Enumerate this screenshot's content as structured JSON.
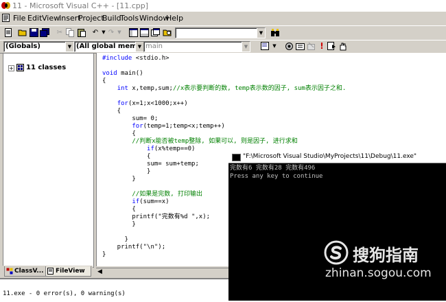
{
  "window": {
    "title": "11 - Microsoft Visual C++ - [11.cpp]"
  },
  "menu": [
    "File",
    "Edit",
    "View",
    "Insert",
    "Project",
    "Build",
    "Tools",
    "Window",
    "Help"
  ],
  "toolbar": {
    "find_value": "",
    "scope_combo": "(Globals)",
    "members_combo": "(All global members",
    "function_combo": "main"
  },
  "classview": {
    "root_label": "11 classes"
  },
  "tabs": [
    "ClassV...",
    "FileView"
  ],
  "code_lines": [
    "#include <stdio.h>",
    "",
    "void main()",
    "{",
    "    int x,temp,sum;//x表示要判断的数, temp表示数的因子, sum表示因子之和.",
    "",
    "    for(x=1;x<1000;x++)",
    "    {",
    "        sum= 0;",
    "        for(temp=1;temp<x;temp++)",
    "        {",
    "        //判断x能否被temp整除, 如果可以, 则是因子, 进行求和",
    "            if(x%temp==0)",
    "            {",
    "            sum= sum+temp;",
    "            }",
    "        }",
    "",
    "        //如果是完数, 打印输出",
    "        if(sum==x)",
    "        {",
    "        printf(\"完数有%d \",x);",
    "        }",
    "",
    "      }",
    "    printf(\"\\n\");",
    "}"
  ],
  "output": {
    "line": "11.exe - 0 error(s), 0 warning(s)"
  },
  "console": {
    "title": "\"F:\\Microsoft Visual Studio\\MyProjects\\11\\Debug\\11.exe\"",
    "line1": "完数有6 完数有28 完数有496",
    "line2": "Press any key to continue"
  },
  "watermark": {
    "brand": "搜狗指南",
    "url": "zhinan.sogou.com"
  }
}
